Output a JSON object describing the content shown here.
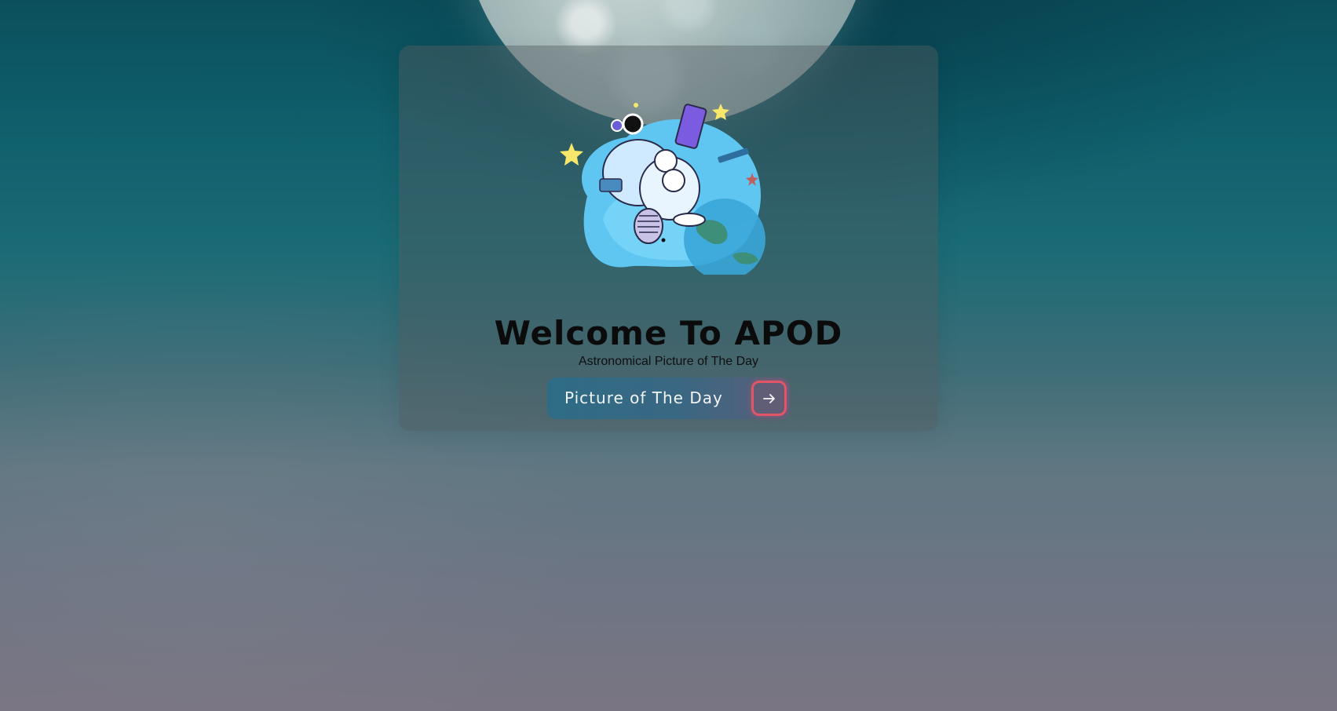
{
  "page": {
    "title": "Welcome To APOD",
    "subtitle": "Astronomical Picture of The Day"
  },
  "cta": {
    "label": "Picture of The Day",
    "icon": "arrow-right-icon"
  },
  "illustration": {
    "icon": "astronaut-illustration"
  },
  "colors": {
    "title_text": "#0b0b0b",
    "button_gradient_start": "#2e6c86",
    "button_gradient_end": "#5a5f7a",
    "arrow_border": "#e25567"
  }
}
